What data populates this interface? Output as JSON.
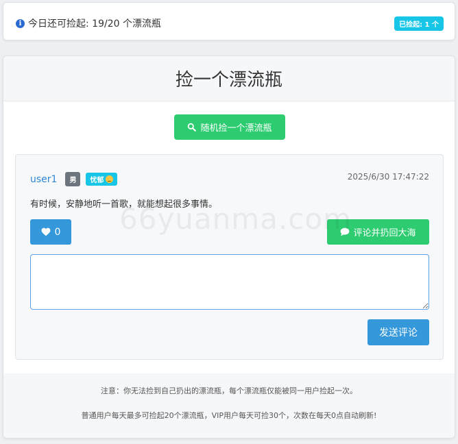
{
  "top_bar": {
    "remaining_text": "今日还可捡起: 19/20 个漂流瓶",
    "picked_badge": "已捡起: 1 个"
  },
  "main": {
    "title": "捡一个漂流瓶",
    "pick_button": "随机捡一个漂流瓶"
  },
  "bottle": {
    "username": "user1",
    "gender": "男",
    "mood": "忧郁",
    "timestamp": "2025/6/30 17:47:22",
    "content": "有时候，安静地听一首歌，就能想起很多事情。",
    "likes": "0",
    "throw_back_button": "评论并扔回大海",
    "comment_placeholder": "",
    "send_button": "发送评论"
  },
  "footer": {
    "note1": "注意：你无法捡到自己扔出的漂流瓶，每个漂流瓶仅能被同一用户捡起一次。",
    "note2": "普通用户每天最多可捡起20个漂流瓶，VIP用户每天可捡30个，次数在每天0点自动刷新!"
  },
  "watermark": "66yuanma.com",
  "colors": {
    "primary_blue": "#3498db",
    "success_green": "#2ecc71",
    "info_cyan": "#17c5e6",
    "secondary_gray": "#6c757d"
  },
  "icons": [
    "info-icon",
    "search-icon",
    "heart-icon",
    "comment-icon",
    "mood-face-icon"
  ]
}
